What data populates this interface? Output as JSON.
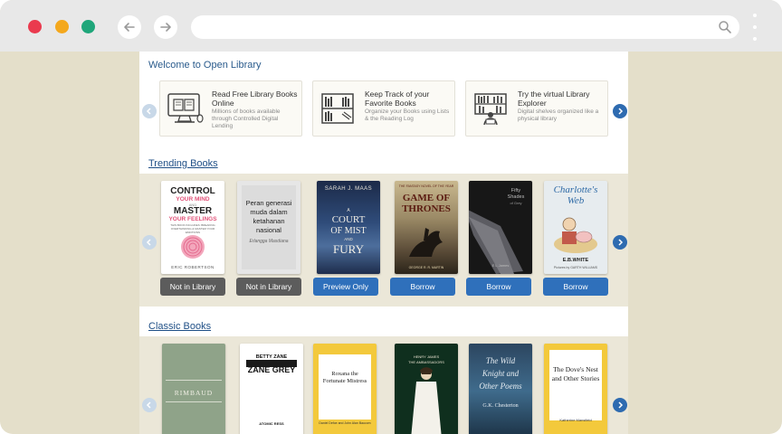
{
  "browser": {
    "url": "",
    "icons": {
      "back": "arrow-left-icon",
      "forward": "arrow-right-icon",
      "search": "magnifier-icon",
      "menu": "kebab-menu-icon"
    }
  },
  "welcome": {
    "title": "Welcome to Open Library",
    "features": [
      {
        "title": "Read Free Library Books Online",
        "desc": "Millions of books available through Controlled Digital Lending",
        "icon": "computer-reading-icon"
      },
      {
        "title": "Keep Track of your Favorite Books",
        "desc": "Organize your Books using Lists & the Reading Log",
        "icon": "bookshelf-icon"
      },
      {
        "title": "Try the virtual Library Explorer",
        "desc": "Digital shelves organized like a physical library",
        "icon": "library-explorer-icon"
      }
    ]
  },
  "trending": {
    "title": "Trending Books",
    "books": [
      {
        "cover": {
          "line1": "CONTROL",
          "line2": "YOUR MIND",
          "line3": "AND",
          "line4": "MASTER",
          "line5": "YOUR FEELINGS",
          "line6": "THIS BOOK INCLUDES: BREAKING OVERTHINKING & MASTER YOUR EMOTIONS",
          "author": "ERIC ROBERTSON"
        },
        "button": "Not in Library",
        "style": "gray"
      },
      {
        "cover": {
          "title": "Peran generasi muda dalam ketahanan nasional",
          "author": "Erlangga Masdiana"
        },
        "button": "Not in Library",
        "style": "gray"
      },
      {
        "cover": {
          "author": "SARAH J. MAAS",
          "line1": "A",
          "line2": "COURT",
          "line3": "OF MIST",
          "line4": "AND",
          "line5": "FURY"
        },
        "button": "Preview Only",
        "style": "blue"
      },
      {
        "cover": {
          "top": "THE FANTASY NOVEL OF THE YEAR",
          "line1": "GAME OF",
          "line2": "THRONES",
          "author": "GEORGE R. R. MARTIN"
        },
        "button": "Borrow",
        "style": "blue"
      },
      {
        "cover": {
          "line1": "Fifty",
          "line2": "Shades",
          "line3": "of Grey",
          "author": "E L James"
        },
        "button": "Borrow",
        "style": "blue"
      },
      {
        "cover": {
          "line1": "Charlotte's",
          "line2": "Web",
          "author": "E.B.WHITE",
          "illus": "Pictures by GARTH WILLIAMS"
        },
        "button": "Borrow",
        "style": "blue"
      }
    ]
  },
  "classic": {
    "title": "Classic Books",
    "books": [
      {
        "cover": {
          "title": "RIMBAUD"
        }
      },
      {
        "cover": {
          "author": "BETTY ZANE",
          "title": "ZANE GREY",
          "footer": "ATOMIC RESS"
        }
      },
      {
        "cover": {
          "title": "Roxana the Fortunate Mistress",
          "author": "Daniel Defoe and John Alan Baucom"
        }
      },
      {
        "cover": {
          "author": "HENRY JAMES",
          "title": "THE AMBASSADORS"
        }
      },
      {
        "cover": {
          "line1": "The Wild",
          "line2": "Knight and",
          "line3": "Other Poems",
          "author": "G.K. Chesterton"
        }
      },
      {
        "cover": {
          "title": "The Dove's Nest and Other Stories",
          "author": "Katherine Mansfield"
        }
      }
    ]
  }
}
